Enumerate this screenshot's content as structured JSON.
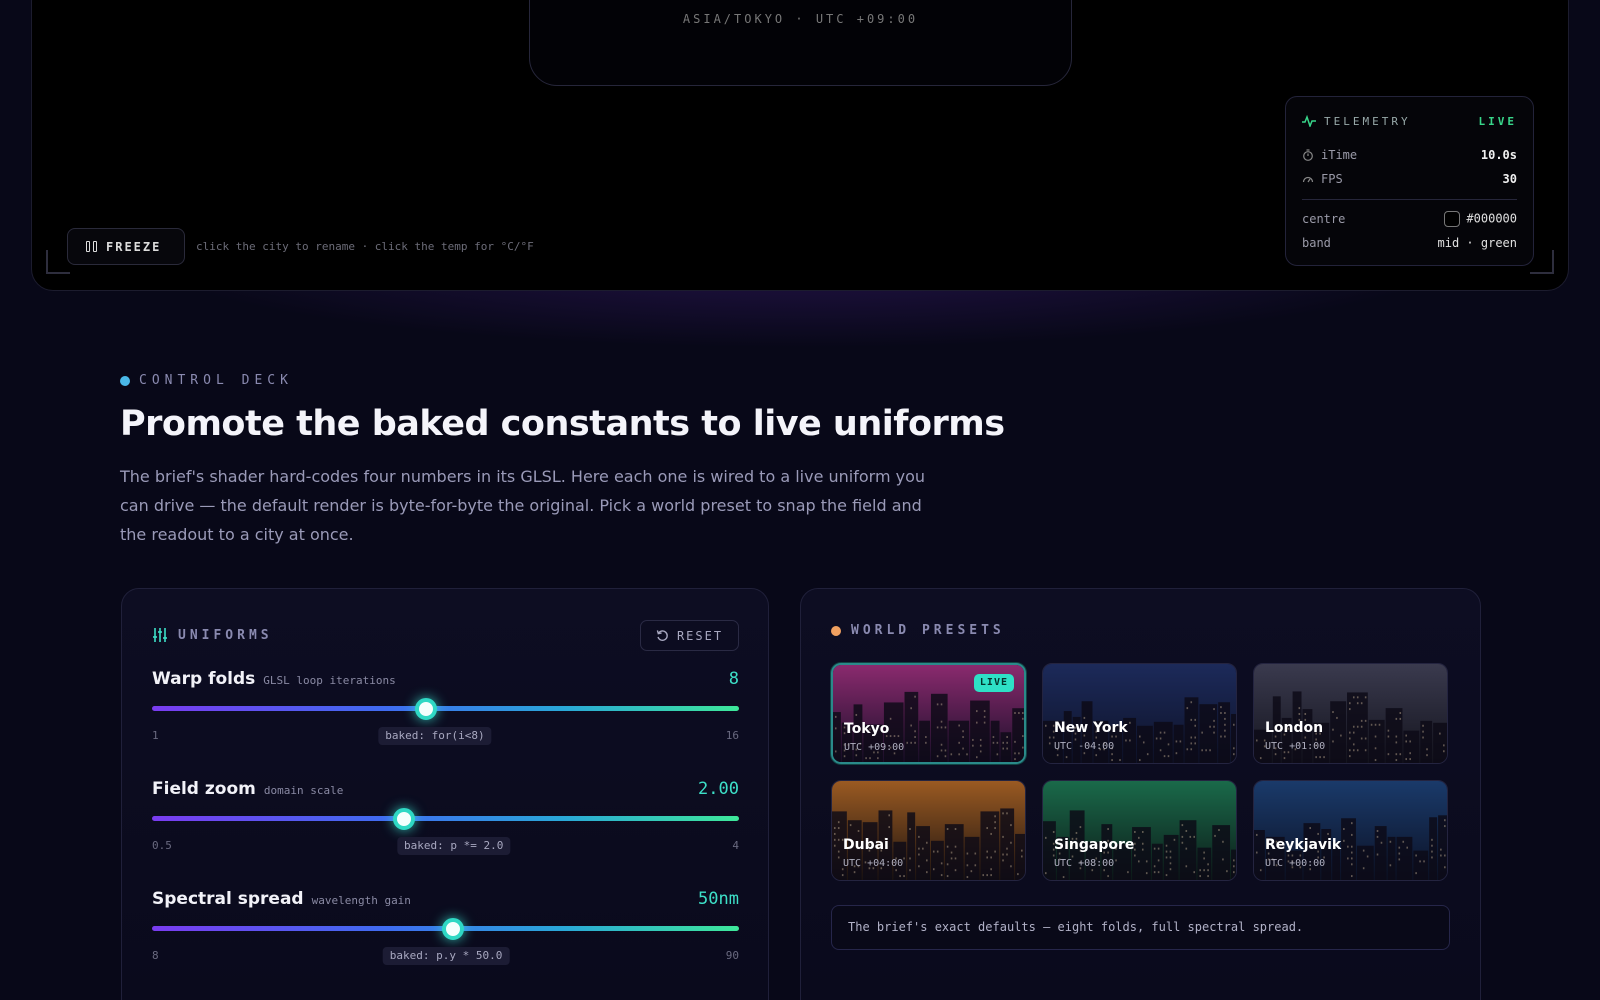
{
  "stage": {
    "clock": {
      "timezone": "ASIA/TOKYO · UTC +09:00"
    },
    "freeze_label": "FREEZE",
    "hint": "click the city to rename · click the temp for °C/°F"
  },
  "telemetry": {
    "title": "TELEMETRY",
    "status": "LIVE",
    "status_color": "#38d68a",
    "rows": [
      {
        "label": "iTime",
        "value": "10.0s",
        "icon": "stopwatch-icon"
      },
      {
        "label": "FPS",
        "value": "30",
        "icon": "gauge-icon"
      }
    ],
    "centre": {
      "label": "centre",
      "value": "#000000"
    },
    "band": {
      "label": "band",
      "value": "mid · green"
    }
  },
  "deck": {
    "eyebrow": "CONTROL DECK",
    "headline": "Promote the baked constants to live uniforms",
    "lede": "The brief's shader hard-codes four numbers in its GLSL. Here each one is wired to a live uniform you can drive — the default render is byte-for-byte the original. Pick a world preset to snap the field and the readout to a city at once."
  },
  "uniforms": {
    "title": "UNIFORMS",
    "reset_label": "RESET",
    "items": [
      {
        "label": "Warp folds",
        "sub": "GLSL loop iterations",
        "value": "8",
        "min": "1",
        "max": "16",
        "fraction": 0.467,
        "baked": "baked: for(i<8)"
      },
      {
        "label": "Field zoom",
        "sub": "domain scale",
        "value": "2.00",
        "min": "0.5",
        "max": "4",
        "fraction": 0.429,
        "baked": "baked: p *= 2.0"
      },
      {
        "label": "Spectral spread",
        "sub": "wavelength gain",
        "value": "50nm",
        "min": "8",
        "max": "90",
        "fraction": 0.512,
        "baked": "baked: p.y * 50.0"
      }
    ]
  },
  "world": {
    "title": "WORLD PRESETS",
    "accent": "#f0a060",
    "presets": [
      {
        "name": "Tokyo",
        "utc": "UTC +09:00",
        "live": "LIVE",
        "sky_top": "#8a2a6e",
        "sky_bottom": "#1a0f2a"
      },
      {
        "name": "New York",
        "utc": "UTC -04:00",
        "sky_top": "#1c2a5a",
        "sky_bottom": "#0e1228"
      },
      {
        "name": "London",
        "utc": "UTC +01:00",
        "sky_top": "#3a3a4e",
        "sky_bottom": "#14141e"
      },
      {
        "name": "Dubai",
        "utc": "UTC +04:00",
        "sky_top": "#9a5a22",
        "sky_bottom": "#1e1410"
      },
      {
        "name": "Singapore",
        "utc": "UTC +08:00",
        "sky_top": "#1a6a4a",
        "sky_bottom": "#0c1a18"
      },
      {
        "name": "Reykjavik",
        "utc": "UTC +00:00",
        "sky_top": "#1a3a6a",
        "sky_bottom": "#0c1226"
      }
    ],
    "note": "The brief's exact defaults — eight folds, full spectral spread."
  }
}
